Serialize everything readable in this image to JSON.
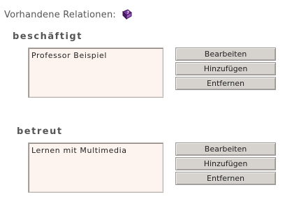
{
  "header": {
    "title": "Vorhandene Relationen:",
    "icon": "book-icon"
  },
  "sections": [
    {
      "title": "beschäftigt",
      "items": [
        "Professor Beispiel"
      ],
      "buttons": {
        "edit": "Bearbeiten",
        "add": "Hinzufügen",
        "remove": "Entfernen"
      }
    },
    {
      "title": "betreut",
      "items": [
        "Lernen mit Multimedia"
      ],
      "buttons": {
        "edit": "Bearbeiten",
        "add": "Hinzufügen",
        "remove": "Entfernen"
      }
    }
  ],
  "colors": {
    "listbox_bg": "#fdf4ef",
    "button_bg": "#d6d3cf",
    "icon_purple": "#6a2a8c"
  }
}
